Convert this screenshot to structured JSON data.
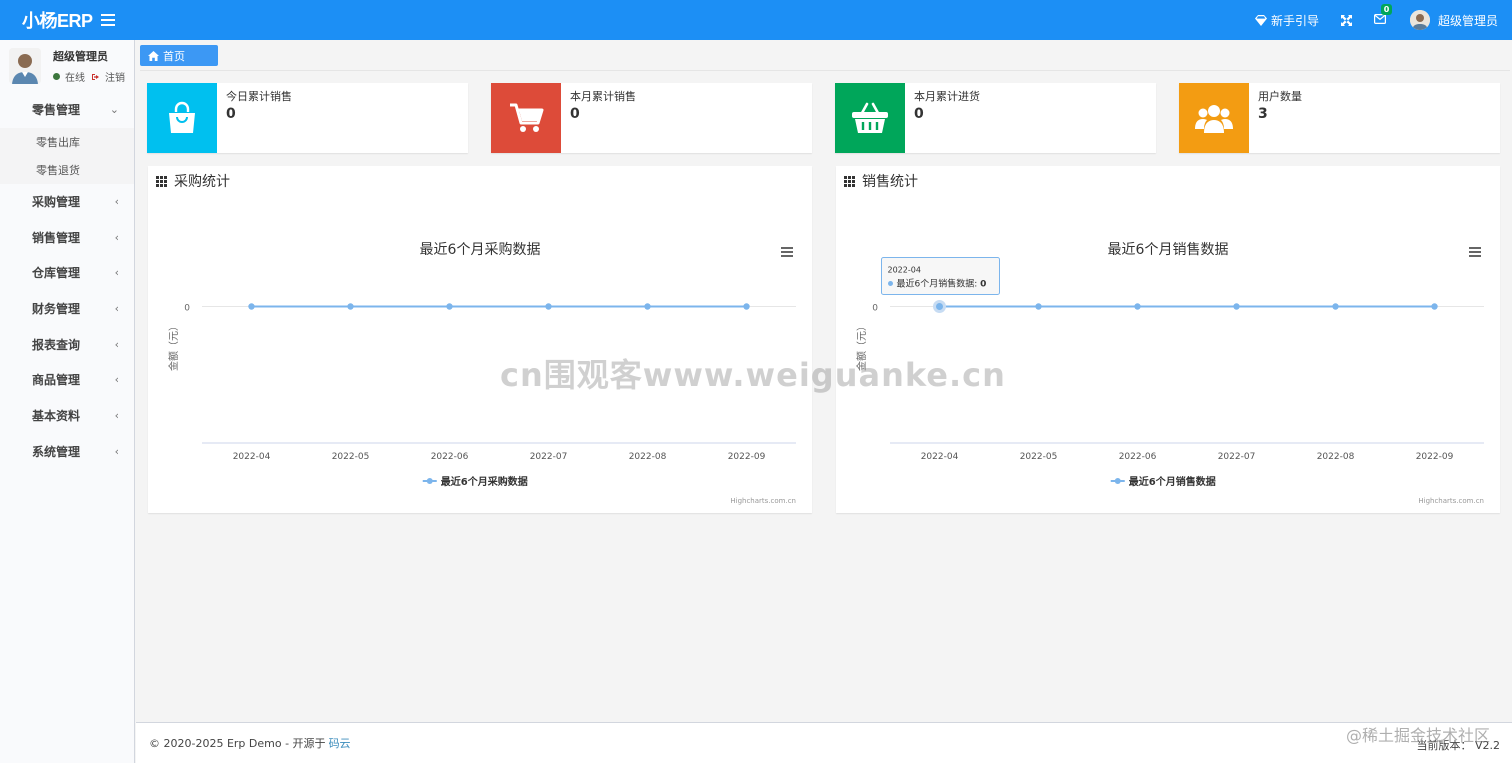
{
  "app": {
    "logo": "小杨ERP"
  },
  "topbar": {
    "guide_label": "新手引导",
    "mail_badge": "0",
    "user_name": "超级管理员"
  },
  "sidebar": {
    "user": {
      "name": "超级管理员",
      "status": "在线",
      "logout": "注销"
    },
    "menu": [
      {
        "label": "零售管理",
        "expanded": true,
        "children": [
          "零售出库",
          "零售退货"
        ]
      },
      {
        "label": "采购管理"
      },
      {
        "label": "销售管理"
      },
      {
        "label": "仓库管理"
      },
      {
        "label": "财务管理"
      },
      {
        "label": "报表查询"
      },
      {
        "label": "商品管理"
      },
      {
        "label": "基本资料"
      },
      {
        "label": "系统管理"
      }
    ]
  },
  "tabs": [
    {
      "label": "首页",
      "active": true
    }
  ],
  "stats": [
    {
      "label": "今日累计销售",
      "value": "0",
      "color": "#00c0ef",
      "icon": "shopping-bag-icon"
    },
    {
      "label": "本月累计销售",
      "value": "0",
      "color": "#dd4b39",
      "icon": "shopping-cart-icon"
    },
    {
      "label": "本月累计进货",
      "value": "0",
      "color": "#00a65a",
      "icon": "shopping-basket-icon"
    },
    {
      "label": "用户数量",
      "value": "3",
      "color": "#f39c12",
      "icon": "users-icon"
    }
  ],
  "panels": {
    "purchase": {
      "title": "采购统计"
    },
    "sales": {
      "title": "销售统计"
    }
  },
  "chart_data": [
    {
      "type": "line",
      "title": "最近6个月采购数据",
      "ylabel": "金额（元）",
      "categories": [
        "2022-04",
        "2022-05",
        "2022-06",
        "2022-07",
        "2022-08",
        "2022-09"
      ],
      "series": [
        {
          "name": "最近6个月采购数据",
          "values": [
            0,
            0,
            0,
            0,
            0,
            0
          ]
        }
      ],
      "yticks": [
        0
      ],
      "color": "#7cb5ec",
      "credits": "Highcharts.com.cn",
      "legend": "bottom-center"
    },
    {
      "type": "line",
      "title": "最近6个月销售数据",
      "ylabel": "金额（元）",
      "categories": [
        "2022-04",
        "2022-05",
        "2022-06",
        "2022-07",
        "2022-08",
        "2022-09"
      ],
      "series": [
        {
          "name": "最近6个月销售数据",
          "values": [
            0,
            0,
            0,
            0,
            0,
            0
          ]
        }
      ],
      "yticks": [
        0
      ],
      "color": "#7cb5ec",
      "credits": "Highcharts.com.cn",
      "legend": "bottom-center",
      "tooltip": {
        "category": "2022-04",
        "series": "最近6个月销售数据",
        "value": "0"
      }
    }
  ],
  "footer": {
    "copyright": "© 2020-2025 Erp Demo - 开源于",
    "link": "码云",
    "version": "当前版本： V2.2"
  },
  "watermarks": {
    "center": "cn围观客www.weiguanke.cn",
    "corner": "@稀土掘金技术社区"
  }
}
